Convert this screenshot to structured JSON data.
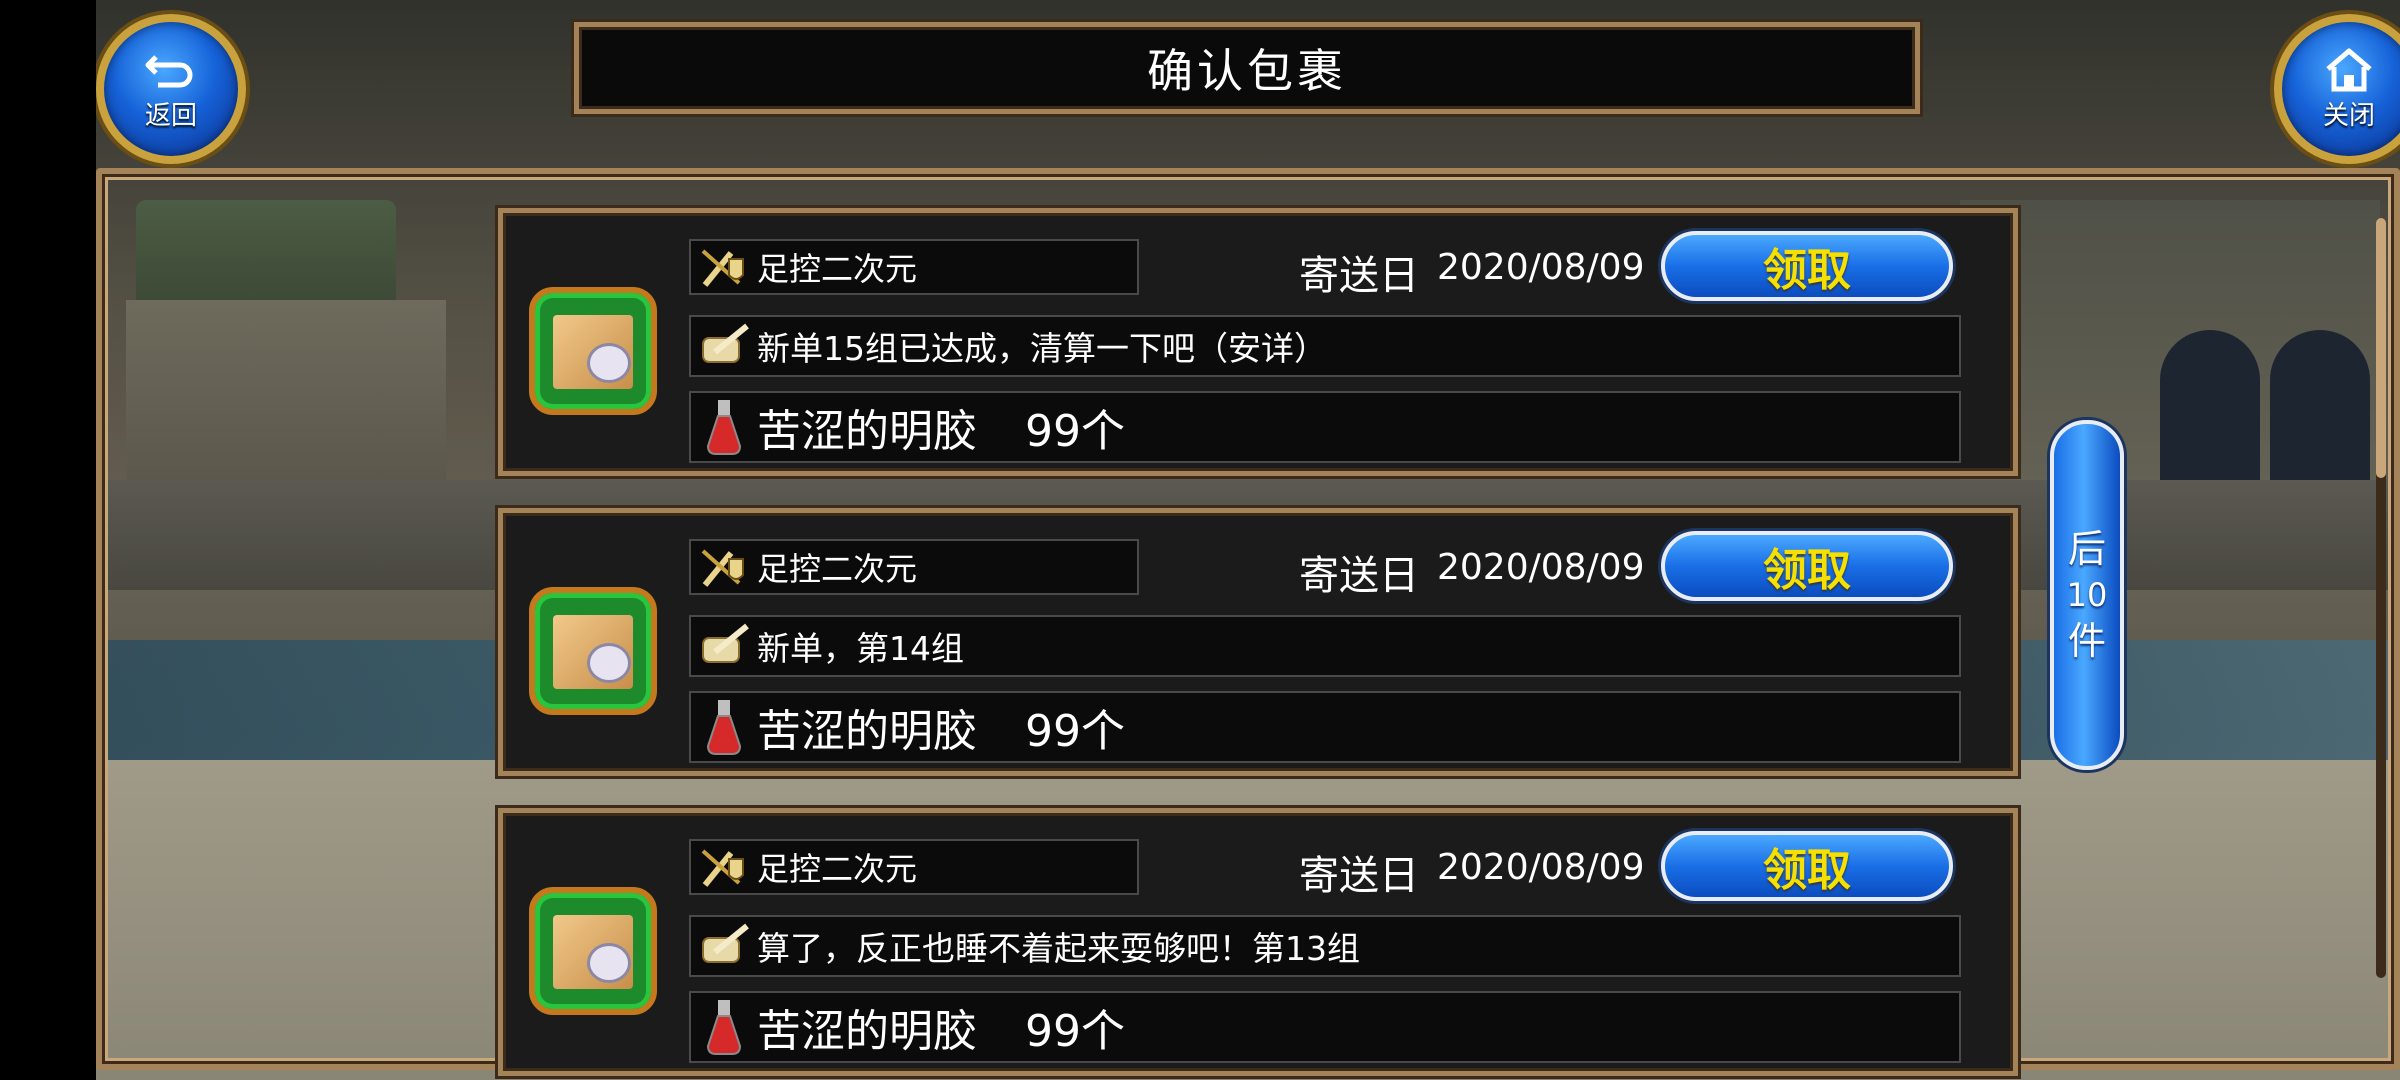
{
  "header": {
    "title": "确认包裹",
    "back_label": "返回",
    "close_label": "关闭"
  },
  "mails": [
    {
      "sender": "足控二次元",
      "date_label": "寄送日",
      "date": "2020/08/09",
      "claim_label": "领取",
      "message": "新单15组已达成，清算一下吧（安详）",
      "item_name": "苦涩的明胶",
      "item_qty": "99个"
    },
    {
      "sender": "足控二次元",
      "date_label": "寄送日",
      "date": "2020/08/09",
      "claim_label": "领取",
      "message": "新单，第14组",
      "item_name": "苦涩的明胶",
      "item_qty": "99个"
    },
    {
      "sender": "足控二次元",
      "date_label": "寄送日",
      "date": "2020/08/09",
      "claim_label": "领取",
      "message": "算了，反正也睡不着起来耍够吧！第13组",
      "item_name": "苦涩的明胶",
      "item_qty": "99个"
    }
  ],
  "pager": {
    "next_top": "后",
    "next_count": "10",
    "next_bottom": "件"
  },
  "icons": {
    "sender": "sword-shield-icon",
    "message": "scroll-quill-icon",
    "item": "potion-flask-icon",
    "package": "package-box-icon",
    "back": "back-arrow-icon",
    "close": "home-icon"
  },
  "colors": {
    "accent_blue": "#1a6fe6",
    "claim_text": "#f5e000",
    "frame_gold": "#a48358",
    "package_green": "#27c63e"
  }
}
